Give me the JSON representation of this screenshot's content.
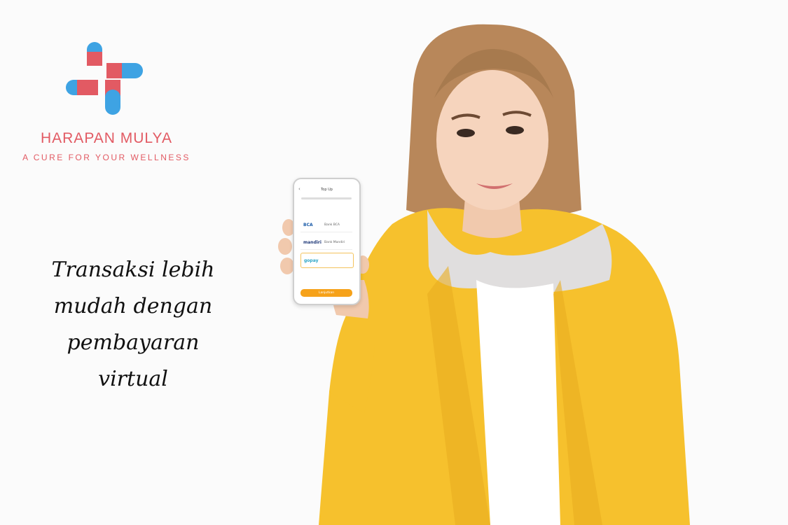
{
  "brand": {
    "name": "HARAPAN MULYA",
    "tagline": "A CURE FOR YOUR WELLNESS",
    "colors": {
      "red": "#e25a63",
      "blue": "#3ea3e3"
    }
  },
  "headline": {
    "lines": [
      "Transaksi lebih",
      "mudah dengan",
      "pembayaran",
      "virtual"
    ]
  },
  "phone": {
    "title": "Top Up",
    "banks": [
      {
        "logo": "BCA",
        "name": "Bank BCA"
      },
      {
        "logo": "mandiri",
        "name": "Bank Mandiri"
      },
      {
        "logo": "gopay",
        "name": ""
      }
    ],
    "button_label": "Lanjutkan"
  },
  "illustration": {
    "jacket_color": "#f6c12d"
  }
}
